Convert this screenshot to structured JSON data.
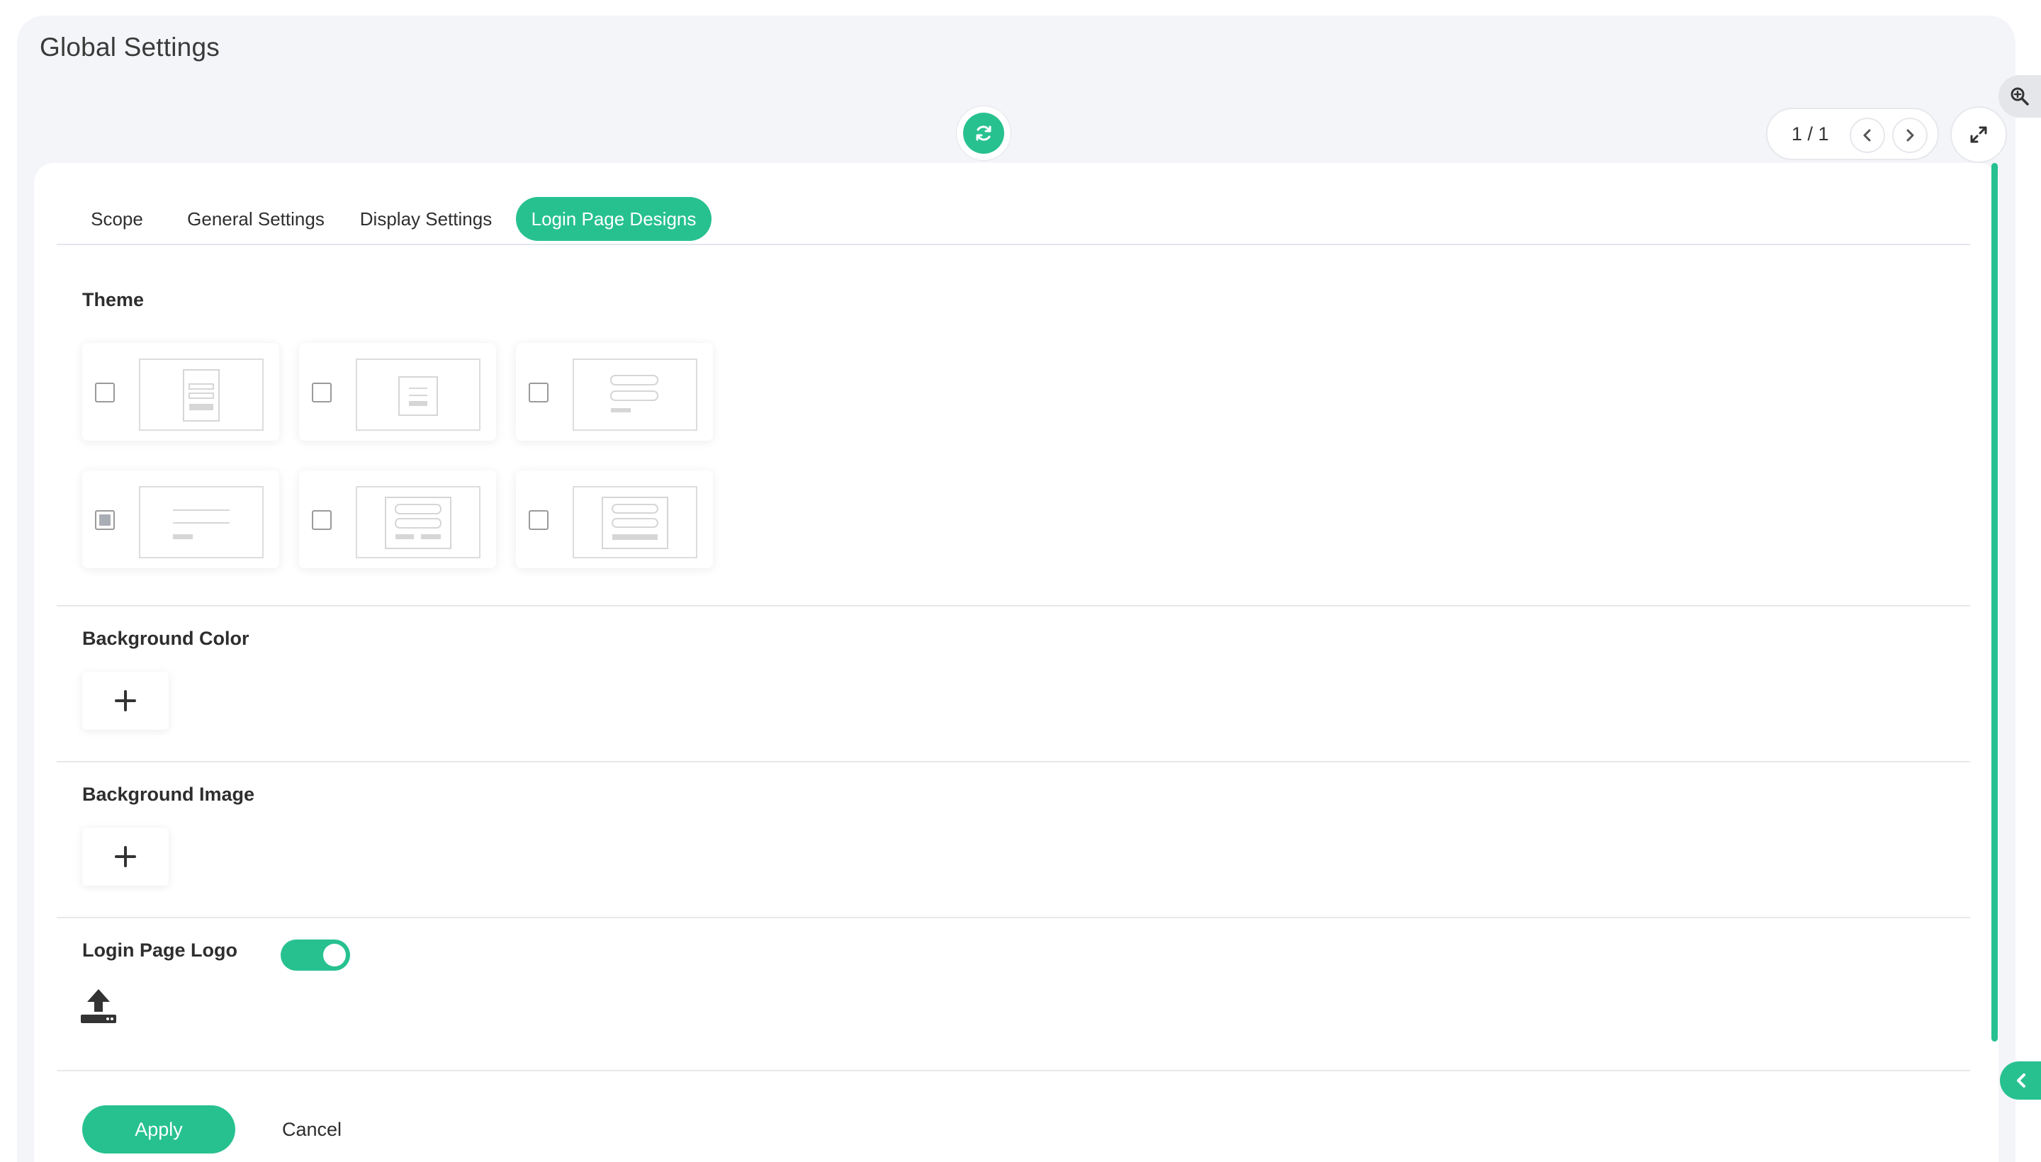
{
  "header": {
    "title": "Global Settings",
    "pager": {
      "current": 1,
      "total": 1,
      "label": "1 / 1"
    }
  },
  "tabs": [
    {
      "label": "Scope",
      "active": false
    },
    {
      "label": "General Settings",
      "active": false
    },
    {
      "label": "Display Settings",
      "active": false
    },
    {
      "label": "Login Page Designs",
      "active": true
    }
  ],
  "theme": {
    "title": "Theme",
    "options": [
      {
        "checked": false
      },
      {
        "checked": false
      },
      {
        "checked": false
      },
      {
        "checked": true
      },
      {
        "checked": false
      },
      {
        "checked": false
      }
    ]
  },
  "background_color": {
    "title": "Background Color",
    "add_label": "+"
  },
  "background_image": {
    "title": "Background Image",
    "add_label": "+"
  },
  "login_logo": {
    "title": "Login Page Logo",
    "enabled": true
  },
  "actions": {
    "apply_label": "Apply",
    "cancel_label": "Cancel"
  },
  "colors": {
    "accent": "#27c190",
    "background": "#f4f5f8",
    "card": "#ffffff"
  },
  "icons": [
    "refresh-icon",
    "chevron-left-icon",
    "chevron-right-icon",
    "expand-icon",
    "zoom-icon",
    "collapse-icon",
    "plus-icon",
    "upload-icon"
  ]
}
